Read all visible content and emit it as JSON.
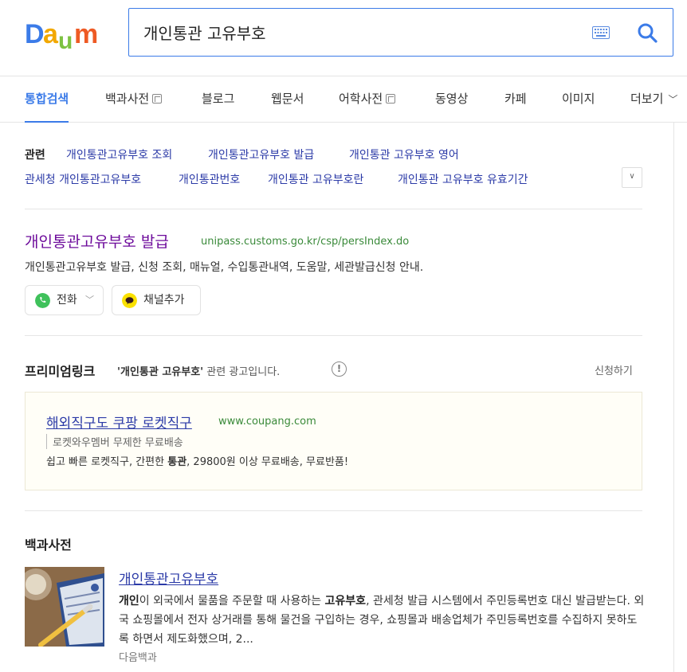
{
  "search": {
    "query": "개인통관 고유부호"
  },
  "tabs": [
    {
      "label": "통합검색"
    },
    {
      "label": "백과사전"
    },
    {
      "label": "블로그"
    },
    {
      "label": "웹문서"
    },
    {
      "label": "어학사전"
    },
    {
      "label": "동영상"
    },
    {
      "label": "카페"
    },
    {
      "label": "이미지"
    },
    {
      "label": "더보기"
    }
  ],
  "related": {
    "label": "관련",
    "links": [
      "개인통관고유부호 조회",
      "개인통관고유부호 발급",
      "개인통관 고유부호 영어",
      "관세청 개인통관고유부호",
      "개인통관번호",
      "개인통관 고유부호란",
      "개인통관 고유부호 유효기간"
    ]
  },
  "site": {
    "title": "개인통관고유부호 발급",
    "url": "unipass.customs.go.kr/csp/persIndex.do",
    "desc": "개인통관고유부호 발급, 신청 조회, 매뉴얼, 수입통관내역, 도움말, 세관발급신청 안내.",
    "chips": [
      {
        "label": "전화",
        "color": "#3fc15b"
      },
      {
        "label": "채널추가",
        "color": "#fae100"
      }
    ]
  },
  "premium": {
    "title": "프리미엄링크",
    "sub_query": "'개인통관 고유부호'",
    "sub_text": " 관련 광고입니다.",
    "apply": "신청하기",
    "ad": {
      "title": "해외직구도 쿠팡 로켓직구",
      "url": "www.coupang.com",
      "sub": "로켓와우멤버 무제한 무료배송",
      "desc_pre": "쉽고 빠른 로켓직구, 간편한 ",
      "desc_bold": "통관",
      "desc_post": ", 29800원 이상 무료배송, 무료반품!"
    }
  },
  "encyclopedia": {
    "section_title": "백과사전",
    "item_title": "개인통관고유부호",
    "desc_b1": "개인",
    "desc_1": "이 외국에서 물품을 주문할 때 사용하는 ",
    "desc_b2": "고유부호",
    "desc_2": ", 관세청 발급 시스템에서 주민등록번호 대신 발급받는다. 외국 쇼핑몰에서 전자 상거래를 통해 물건을 구입하는 경우, 쇼핑몰과 배송업체가 주민등록번호를 수집하지 못하도록 하면서 제도화했으며, 2...",
    "source": "다음백과"
  },
  "colors": {
    "accent": "#3b7be8",
    "link": "#2b3aa7",
    "visited": "#6d0b9b",
    "url": "#3a8a3a"
  }
}
